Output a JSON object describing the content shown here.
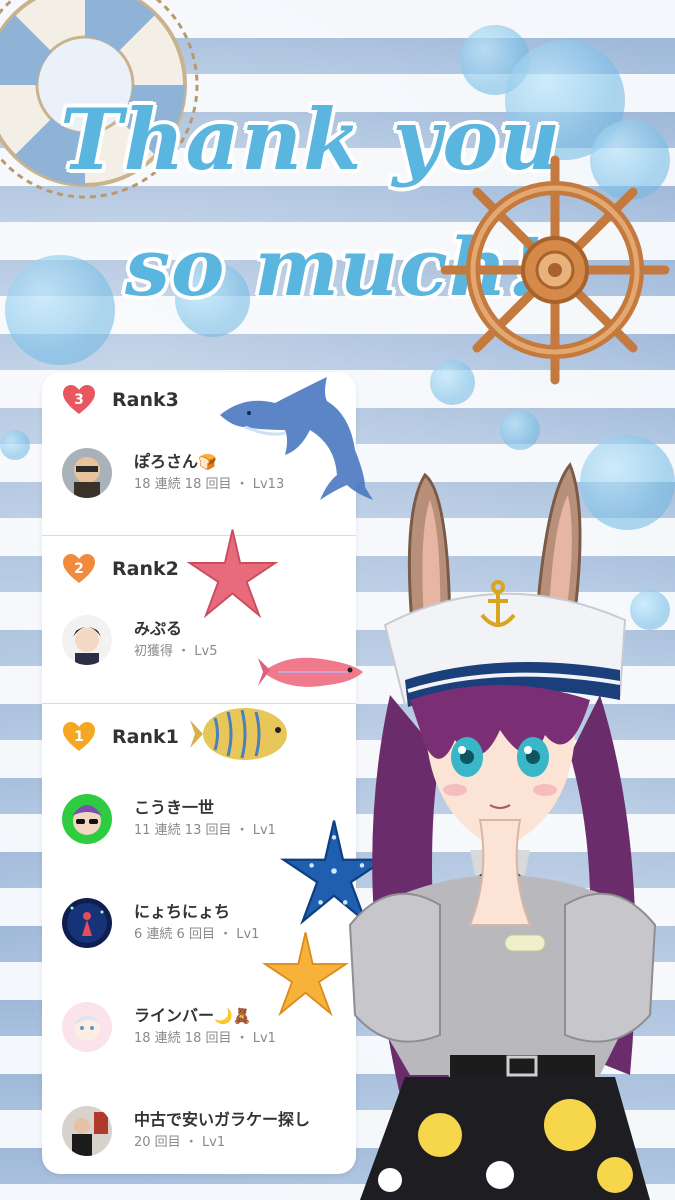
{
  "title": {
    "line1": "Thank you",
    "line2": "so much!"
  },
  "ranks": [
    {
      "label": "Rank3",
      "badge": "3",
      "badge_color": "#e8565f",
      "users": [
        {
          "name": "ぽろさん",
          "emoji": "🍞",
          "meta": "18 連続 18 回目 ・ Lv13"
        }
      ]
    },
    {
      "label": "Rank2",
      "badge": "2",
      "badge_color": "#f08a3e",
      "users": [
        {
          "name": "みぷる",
          "emoji": "",
          "meta": "初獲得 ・ Lv5"
        }
      ]
    },
    {
      "label": "Rank1",
      "badge": "1",
      "badge_color": "#f5a623",
      "users": [
        {
          "name": "こうき一世",
          "emoji": "",
          "meta": "11 連続 13 回目 ・ Lv1"
        },
        {
          "name": "にょちにょち",
          "emoji": "",
          "meta": "6 連続 6 回目 ・ Lv1"
        },
        {
          "name": "ラインバー",
          "emoji": "🌙🧸",
          "meta": "18 連続 18 回目 ・ Lv1"
        },
        {
          "name": "中古で安いガラケー探し",
          "emoji": "",
          "meta": "20 回目 ・ Lv1"
        }
      ]
    }
  ],
  "colors": {
    "title": "#5bb6df",
    "stripe": "#a9c1df",
    "panel": "#ffffff"
  }
}
